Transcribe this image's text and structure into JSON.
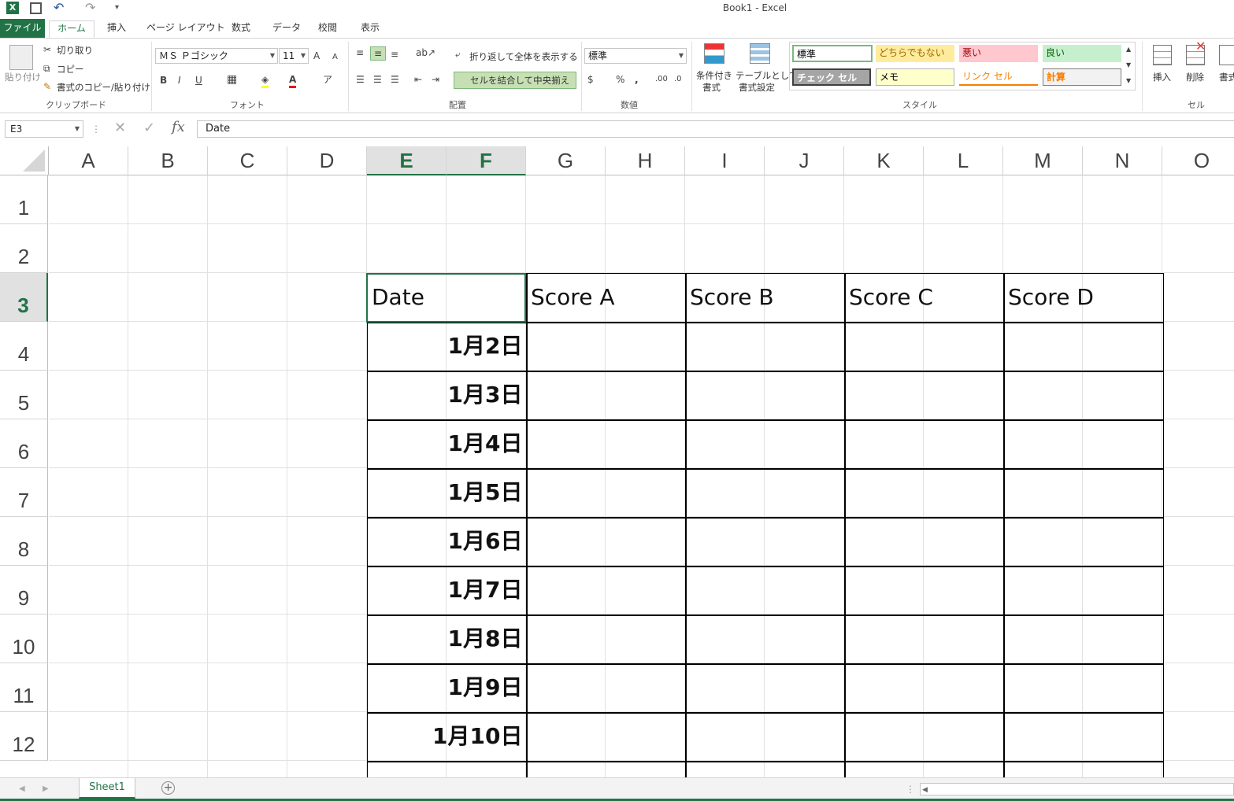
{
  "window": {
    "title": "Book1 - Excel"
  },
  "qat": {
    "excel_icon": "X",
    "save_icon": "save-icon",
    "undo_icon": "↶",
    "redo_icon": "↷",
    "customize_icon": "▾"
  },
  "tabs": [
    "ファイル",
    "ホーム",
    "挿入",
    "ページ レイアウト",
    "数式",
    "データ",
    "校閲",
    "表示"
  ],
  "active_tab": "ホーム",
  "ribbon": {
    "clipboard": {
      "paste": "貼り付け",
      "cut": "切り取り",
      "copy": "コピー",
      "format_painter": "書式のコピー/貼り付け",
      "label": "クリップボード"
    },
    "font": {
      "name": "ＭＳ Ｐゴシック",
      "size": "11",
      "bold": "B",
      "italic": "I",
      "underline": "U",
      "label": "フォント"
    },
    "alignment": {
      "wrap_text": "折り返して全体を表示する",
      "merge_center": "セルを結合して中央揃え",
      "label": "配置"
    },
    "number": {
      "format": "標準",
      "percent": "%",
      "comma": ",",
      "label": "数値"
    },
    "styles": {
      "conditional": [
        "条件付き",
        "書式"
      ],
      "table": [
        "テーブルとして",
        "書式設定"
      ],
      "cells": [
        {
          "label": "標準",
          "bg": "#ffffff",
          "fg": "#000000",
          "border": "#7fb77e"
        },
        {
          "label": "どちらでもない",
          "bg": "#ffeb9c",
          "fg": "#9c6500"
        },
        {
          "label": "悪い",
          "bg": "#ffc7ce",
          "fg": "#9c0006"
        },
        {
          "label": "良い",
          "bg": "#c6efce",
          "fg": "#006100"
        },
        {
          "label": "チェック セル",
          "bg": "#a5a5a5",
          "fg": "#ffffff"
        },
        {
          "label": "メモ",
          "bg": "#ffffcc",
          "fg": "#000000"
        },
        {
          "label": "リンク セル",
          "bg": "#ffffff",
          "fg": "#fa7d00"
        },
        {
          "label": "計算",
          "bg": "#f2f2f2",
          "fg": "#fa7d00"
        }
      ],
      "label": "スタイル"
    },
    "cells_group": {
      "insert": "挿入",
      "delete": "削除",
      "format": "書式",
      "label": "セル"
    }
  },
  "formula_bar": {
    "name_box": "E3",
    "fx": "fx",
    "content": "Date"
  },
  "columns": [
    "A",
    "B",
    "C",
    "D",
    "E",
    "F",
    "G",
    "H",
    "I",
    "J",
    "K",
    "L",
    "M",
    "N",
    "O"
  ],
  "selected_columns": [
    "E",
    "F"
  ],
  "rows": [
    "1",
    "2",
    "3",
    "4",
    "5",
    "6",
    "7",
    "8",
    "9",
    "10",
    "11",
    "12"
  ],
  "selected_row": "3",
  "table": {
    "headers": [
      "Date",
      "Score A",
      "Score B",
      "Score C",
      "Score D"
    ],
    "dates": [
      "1月2日",
      "1月3日",
      "1月4日",
      "1月5日",
      "1月6日",
      "1月7日",
      "1月8日",
      "1月9日",
      "1月10日"
    ]
  },
  "sheets": [
    "Sheet1"
  ],
  "colors": {
    "accent": "#217346"
  }
}
